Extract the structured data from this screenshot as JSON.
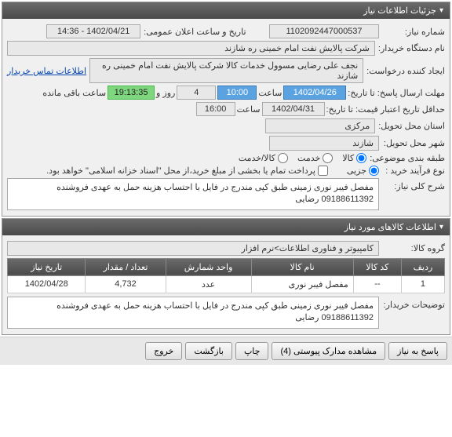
{
  "panel1": {
    "title": "جزئیات اطلاعات نیاز",
    "rows": {
      "reqNoLabel": "شماره نیاز:",
      "reqNo": "1102092447000537",
      "announceLabel": "تاریخ و ساعت اعلان عمومی:",
      "announceVal": "1402/04/21 - 14:36",
      "orgLabel": "نام دستگاه خریدار:",
      "orgVal": "شرکت پالایش نفت امام خمینی ره شازند",
      "creatorLabel": "ایجاد کننده درخواست:",
      "creatorVal": "نجف علی رضایی مسوول خدمات کالا شرکت پالایش نفت امام خمینی ره شازند",
      "contactLink": "اطلاعات تماس خریدار",
      "deadlineLabel": "مهلت ارسال پاسخ: تا تاریخ:",
      "deadlineDate": "1402/04/26",
      "timeLabel": "ساعت",
      "deadlineTime": "10:00",
      "daysVal": "4",
      "daysAfter": "روز و",
      "countdownVal": "19:13:35",
      "remainLabel": "ساعت باقی مانده",
      "validLabel": "حداقل تاریخ اعتبار قیمت: تا تاریخ:",
      "validDate": "1402/04/31",
      "validTime": "16:00",
      "deliveryProvLabel": "استان محل تحویل:",
      "deliveryProvVal": "مرکزی",
      "deliveryCityLabel": "شهر محل تحویل:",
      "deliveryCityVal": "شازند",
      "categoryLabel": "طبقه بندی موضوعی:",
      "catGoods": "کالا",
      "catService": "خدمت",
      "catGoodsService": "کالا/خدمت",
      "procLabel": "نوع فرآیند خرید :",
      "procPartial": "جزیی",
      "procNote": "پرداخت تمام یا بخشی از مبلغ خرید،از محل \"اسناد خزانه اسلامی\" خواهد بود.",
      "summaryLabel": "شرح کلی نیاز:",
      "summaryText": "مفصل فیبر نوری زمینی طبق کپی مندرج در فایل با احتساب هزینه حمل به عهدی فروشنده 09188611392 رضایی"
    }
  },
  "panel2": {
    "title": "اطلاعات كالاهای مورد نیاز",
    "groupLabel": "گروه کالا:",
    "groupVal": "کامپیوتر و فناوری اطلاعات>نرم افزار",
    "table": {
      "headers": [
        "ردیف",
        "کد کالا",
        "نام کالا",
        "واحد شمارش",
        "تعداد / مقدار",
        "تاریخ نیاز"
      ],
      "rows": [
        {
          "idx": "1",
          "code": "--",
          "name": "مفصل فیبر نوری",
          "unit": "عدد",
          "qty": "4,732",
          "date": "1402/04/28"
        }
      ]
    },
    "descLabel": "توضیحات خریدار:",
    "descText": "مفصل فیبر نوری زمینی طبق کپی مندرج در فایل با احتساب هزینه حمل به عهدی فروشنده 09188611392 رضایی"
  },
  "buttons": {
    "respond": "پاسخ به نیاز",
    "attachments": "مشاهده مدارک پیوستی (4)",
    "print": "چاپ",
    "back": "بازگشت",
    "exit": "خروج"
  }
}
